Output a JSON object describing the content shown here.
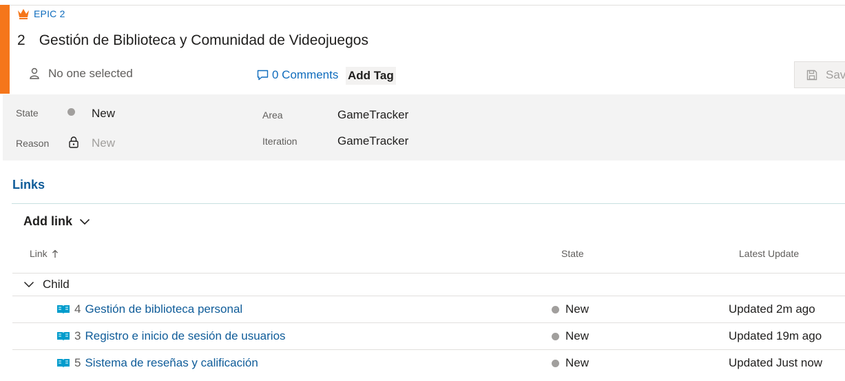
{
  "work_item": {
    "type_label": "EPIC 2",
    "id": "2",
    "title": "Gestión de Biblioteca y Comunidad de Videojuegos",
    "assignee": "No one selected",
    "comments": "0 Comments",
    "add_tag": "Add Tag",
    "save_label": "Save"
  },
  "fields": {
    "state_label": "State",
    "state_value": "New",
    "reason_label": "Reason",
    "reason_value": "New",
    "area_label": "Area",
    "area_value": "GameTracker",
    "iteration_label": "Iteration",
    "iteration_value": "GameTracker"
  },
  "links": {
    "section_title": "Links",
    "add_link": "Add link",
    "columns": {
      "link": "Link",
      "state": "State",
      "latest_update": "Latest Update"
    },
    "group": "Child",
    "rows": [
      {
        "id": "4",
        "title": "Gestión de biblioteca personal",
        "state": "New",
        "update": "Updated 2m ago"
      },
      {
        "id": "3",
        "title": "Registro e inicio de sesión de usuarios",
        "state": "New",
        "update": "Updated 19m ago"
      },
      {
        "id": "5",
        "title": "Sistema de reseñas y calificación",
        "state": "New",
        "update": "Updated Just now"
      }
    ]
  },
  "icons": {
    "type": "crown-icon",
    "assignee": "person-icon",
    "comments": "comment-icon",
    "save": "save-icon",
    "reason": "lock-icon",
    "sort": "arrow-up-icon",
    "add_link_chevron": "chevron-down-icon",
    "group_chevron": "chevron-down-icon",
    "row_type": "book-icon"
  },
  "colors": {
    "epic_accent": "#f5761a",
    "link_blue": "#0f6cbd",
    "state_new": "#a19f9d",
    "book_icon": "#009ccc"
  }
}
